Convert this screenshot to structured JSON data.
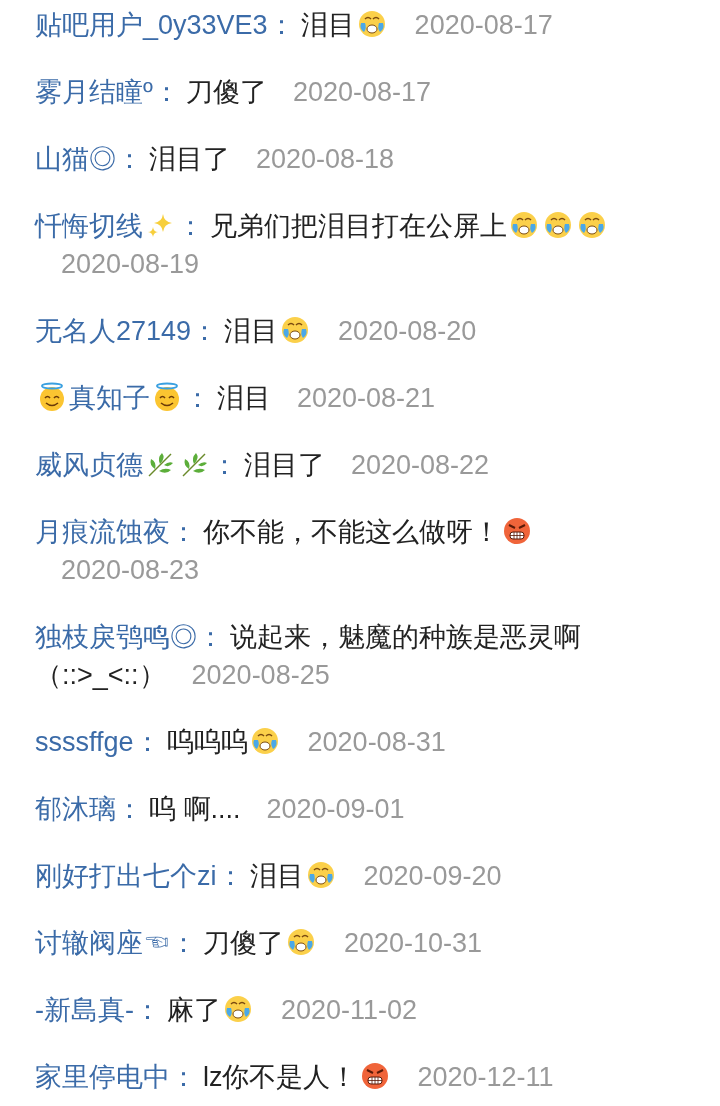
{
  "comments": [
    {
      "name": [
        {
          "kind": "text",
          "text": "贴吧用户_0y33VE3"
        }
      ],
      "colon": "：",
      "content": [
        {
          "kind": "text",
          "text": "泪目"
        },
        {
          "kind": "crying"
        }
      ],
      "date": "2020-08-17"
    },
    {
      "name": [
        {
          "kind": "text",
          "text": "雾月结瞳º"
        }
      ],
      "colon": "：",
      "content": [
        {
          "kind": "text",
          "text": "刀傻了"
        }
      ],
      "date": "2020-08-17"
    },
    {
      "name": [
        {
          "kind": "text",
          "text": "山猫◎"
        }
      ],
      "colon": "：",
      "content": [
        {
          "kind": "text",
          "text": "泪目了"
        }
      ],
      "date": "2020-08-18"
    },
    {
      "name": [
        {
          "kind": "text",
          "text": "忏悔切线"
        },
        {
          "kind": "sparkles"
        }
      ],
      "colon": "：",
      "content": [
        {
          "kind": "text",
          "text": "兄弟们把泪目打在公屏上"
        },
        {
          "kind": "crying"
        },
        {
          "kind": "crying"
        },
        {
          "kind": "crying"
        }
      ],
      "date": "2020-08-19"
    },
    {
      "name": [
        {
          "kind": "text",
          "text": "无名人27149"
        }
      ],
      "colon": "：",
      "content": [
        {
          "kind": "text",
          "text": "泪目"
        },
        {
          "kind": "crying"
        }
      ],
      "date": "2020-08-20"
    },
    {
      "name": [
        {
          "kind": "halo"
        },
        {
          "kind": "text",
          "text": "真知子"
        },
        {
          "kind": "halo"
        }
      ],
      "colon": "：",
      "content": [
        {
          "kind": "text",
          "text": "泪目"
        }
      ],
      "date": "2020-08-21"
    },
    {
      "name": [
        {
          "kind": "text",
          "text": "威风贞德"
        },
        {
          "kind": "herb"
        },
        {
          "kind": "herb"
        }
      ],
      "colon": "：",
      "content": [
        {
          "kind": "text",
          "text": "泪目了"
        }
      ],
      "date": "2020-08-22"
    },
    {
      "name": [
        {
          "kind": "text",
          "text": "月痕流蚀夜"
        }
      ],
      "colon": "：",
      "content": [
        {
          "kind": "text",
          "text": "你不能，不能这么做呀！"
        },
        {
          "kind": "angry"
        }
      ],
      "date": "2020-08-23"
    },
    {
      "name": [
        {
          "kind": "text",
          "text": "独枝戾鸮鸣◎"
        }
      ],
      "colon": "：",
      "content": [
        {
          "kind": "text",
          "text": "说起来，魅魔的种族是恶灵啊"
        },
        {
          "kind": "text",
          "text": "（::>_<::）"
        }
      ],
      "date": "2020-08-25"
    },
    {
      "name": [
        {
          "kind": "text",
          "text": "ssssffge"
        }
      ],
      "colon": "：",
      "content": [
        {
          "kind": "text",
          "text": "呜呜呜"
        },
        {
          "kind": "crying"
        }
      ],
      "date": "2020-08-31"
    },
    {
      "name": [
        {
          "kind": "text",
          "text": "郁沐璃"
        }
      ],
      "colon": "：",
      "content": [
        {
          "kind": "text",
          "text": "呜 啊...."
        }
      ],
      "date": "2020-09-01"
    },
    {
      "name": [
        {
          "kind": "text",
          "text": "刚好打出七个zi"
        }
      ],
      "colon": "：",
      "content": [
        {
          "kind": "text",
          "text": "泪目"
        },
        {
          "kind": "crying"
        }
      ],
      "date": "2020-09-20"
    },
    {
      "name": [
        {
          "kind": "text",
          "text": "讨辙阀座☜"
        }
      ],
      "colon": "：",
      "content": [
        {
          "kind": "text",
          "text": "刀傻了"
        },
        {
          "kind": "crying"
        }
      ],
      "date": "2020-10-31"
    },
    {
      "name": [
        {
          "kind": "text",
          "text": "-新島真-"
        }
      ],
      "colon": "：",
      "content": [
        {
          "kind": "text",
          "text": "麻了"
        },
        {
          "kind": "crying"
        }
      ],
      "date": "2020-11-02"
    },
    {
      "name": [
        {
          "kind": "text",
          "text": "家里停电中"
        }
      ],
      "colon": "：",
      "content": [
        {
          "kind": "text",
          "text": "lz你不是人！"
        },
        {
          "kind": "angry"
        }
      ],
      "date": "2020-12-11"
    }
  ]
}
